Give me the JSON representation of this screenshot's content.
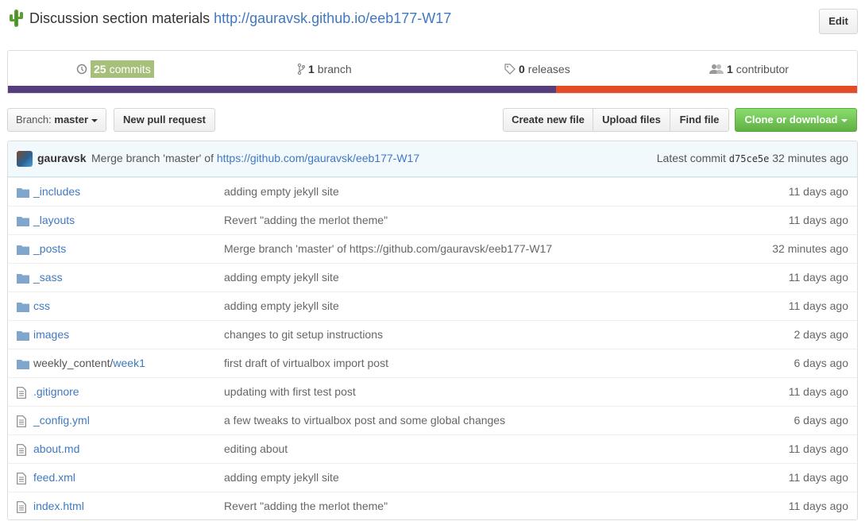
{
  "repo": {
    "description": "Discussion section materials",
    "website": "http://gauravsk.github.io/eeb177-W17",
    "edit_label": "Edit"
  },
  "summary": {
    "commits_count": "25",
    "commits_label": "commits",
    "branches_count": "1",
    "branches_label": "branch",
    "releases_count": "0",
    "releases_label": "releases",
    "contributors_count": "1",
    "contributors_label": "contributor",
    "language_colors": [
      "#563d7c",
      "#e34c26"
    ]
  },
  "toolbar": {
    "branch_prefix": "Branch:",
    "branch_name": "master",
    "new_pr": "New pull request",
    "create_file": "Create new file",
    "upload_files": "Upload files",
    "find_file": "Find file",
    "clone": "Clone or download",
    "clone_color": "#60b044"
  },
  "latest_commit": {
    "author": "gauravsk",
    "message_prefix": "Merge branch 'master' of",
    "message_link": "https://github.com/gauravsk/eeb177-W17",
    "label": "Latest commit",
    "sha": "d75ce5e",
    "age": "32 minutes ago"
  },
  "files": [
    {
      "type": "folder",
      "prefix": "",
      "name": "_includes",
      "message": "adding empty jekyll site",
      "age": "11 days ago"
    },
    {
      "type": "folder",
      "prefix": "",
      "name": "_layouts",
      "message": "Revert \"adding the merlot theme\"",
      "age": "11 days ago"
    },
    {
      "type": "folder",
      "prefix": "",
      "name": "_posts",
      "message": "Merge branch 'master' of https://github.com/gauravsk/eeb177-W17",
      "age": "32 minutes ago"
    },
    {
      "type": "folder",
      "prefix": "",
      "name": "_sass",
      "message": "adding empty jekyll site",
      "age": "11 days ago"
    },
    {
      "type": "folder",
      "prefix": "",
      "name": "css",
      "message": "adding empty jekyll site",
      "age": "11 days ago"
    },
    {
      "type": "folder",
      "prefix": "",
      "name": "images",
      "message": "changes to git setup instructions",
      "age": "2 days ago"
    },
    {
      "type": "folder",
      "prefix": "weekly_content/",
      "name": "week1",
      "message": "first draft of virtualbox import post",
      "age": "6 days ago"
    },
    {
      "type": "file",
      "prefix": "",
      "name": ".gitignore",
      "message": "updating with first test post",
      "age": "11 days ago"
    },
    {
      "type": "file",
      "prefix": "",
      "name": "_config.yml",
      "message": "a few tweaks to virtualbox post and some global changes",
      "age": "6 days ago"
    },
    {
      "type": "file",
      "prefix": "",
      "name": "about.md",
      "message": "editing about",
      "age": "11 days ago"
    },
    {
      "type": "file",
      "prefix": "",
      "name": "feed.xml",
      "message": "adding empty jekyll site",
      "age": "11 days ago"
    },
    {
      "type": "file",
      "prefix": "",
      "name": "index.html",
      "message": "Revert \"adding the merlot theme\"",
      "age": "11 days ago"
    }
  ]
}
